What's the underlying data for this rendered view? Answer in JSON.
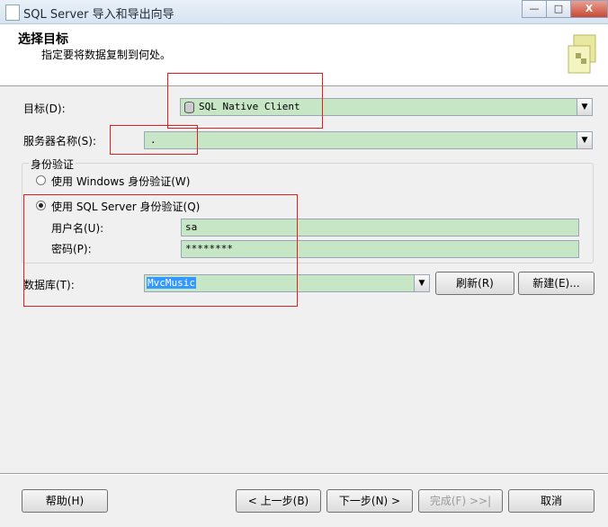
{
  "window": {
    "title": "SQL Server 导入和导出向导",
    "min": "—",
    "max": "□",
    "close": "X"
  },
  "header": {
    "title": "选择目标",
    "subtitle": "指定要将数据复制到何处。"
  },
  "destination": {
    "label": "目标(D):",
    "value": "SQL Native Client"
  },
  "server": {
    "label": "服务器名称(S):",
    "value": "."
  },
  "auth": {
    "group_label": "身份验证",
    "windows_label": "使用 Windows 身份验证(W)",
    "sql_label": "使用 SQL Server 身份验证(Q)",
    "selected": "sql",
    "username_label": "用户名(U):",
    "username_value": "sa",
    "password_label": "密码(P):",
    "password_value": "********"
  },
  "database": {
    "label": "数据库(T):",
    "value": "MvcMusic",
    "refresh": "刷新(R)",
    "new": "新建(E)..."
  },
  "footer": {
    "help": "帮助(H)",
    "back": "< 上一步(B)",
    "next": "下一步(N) >",
    "finish": "完成(F) >>|",
    "cancel": "取消"
  }
}
